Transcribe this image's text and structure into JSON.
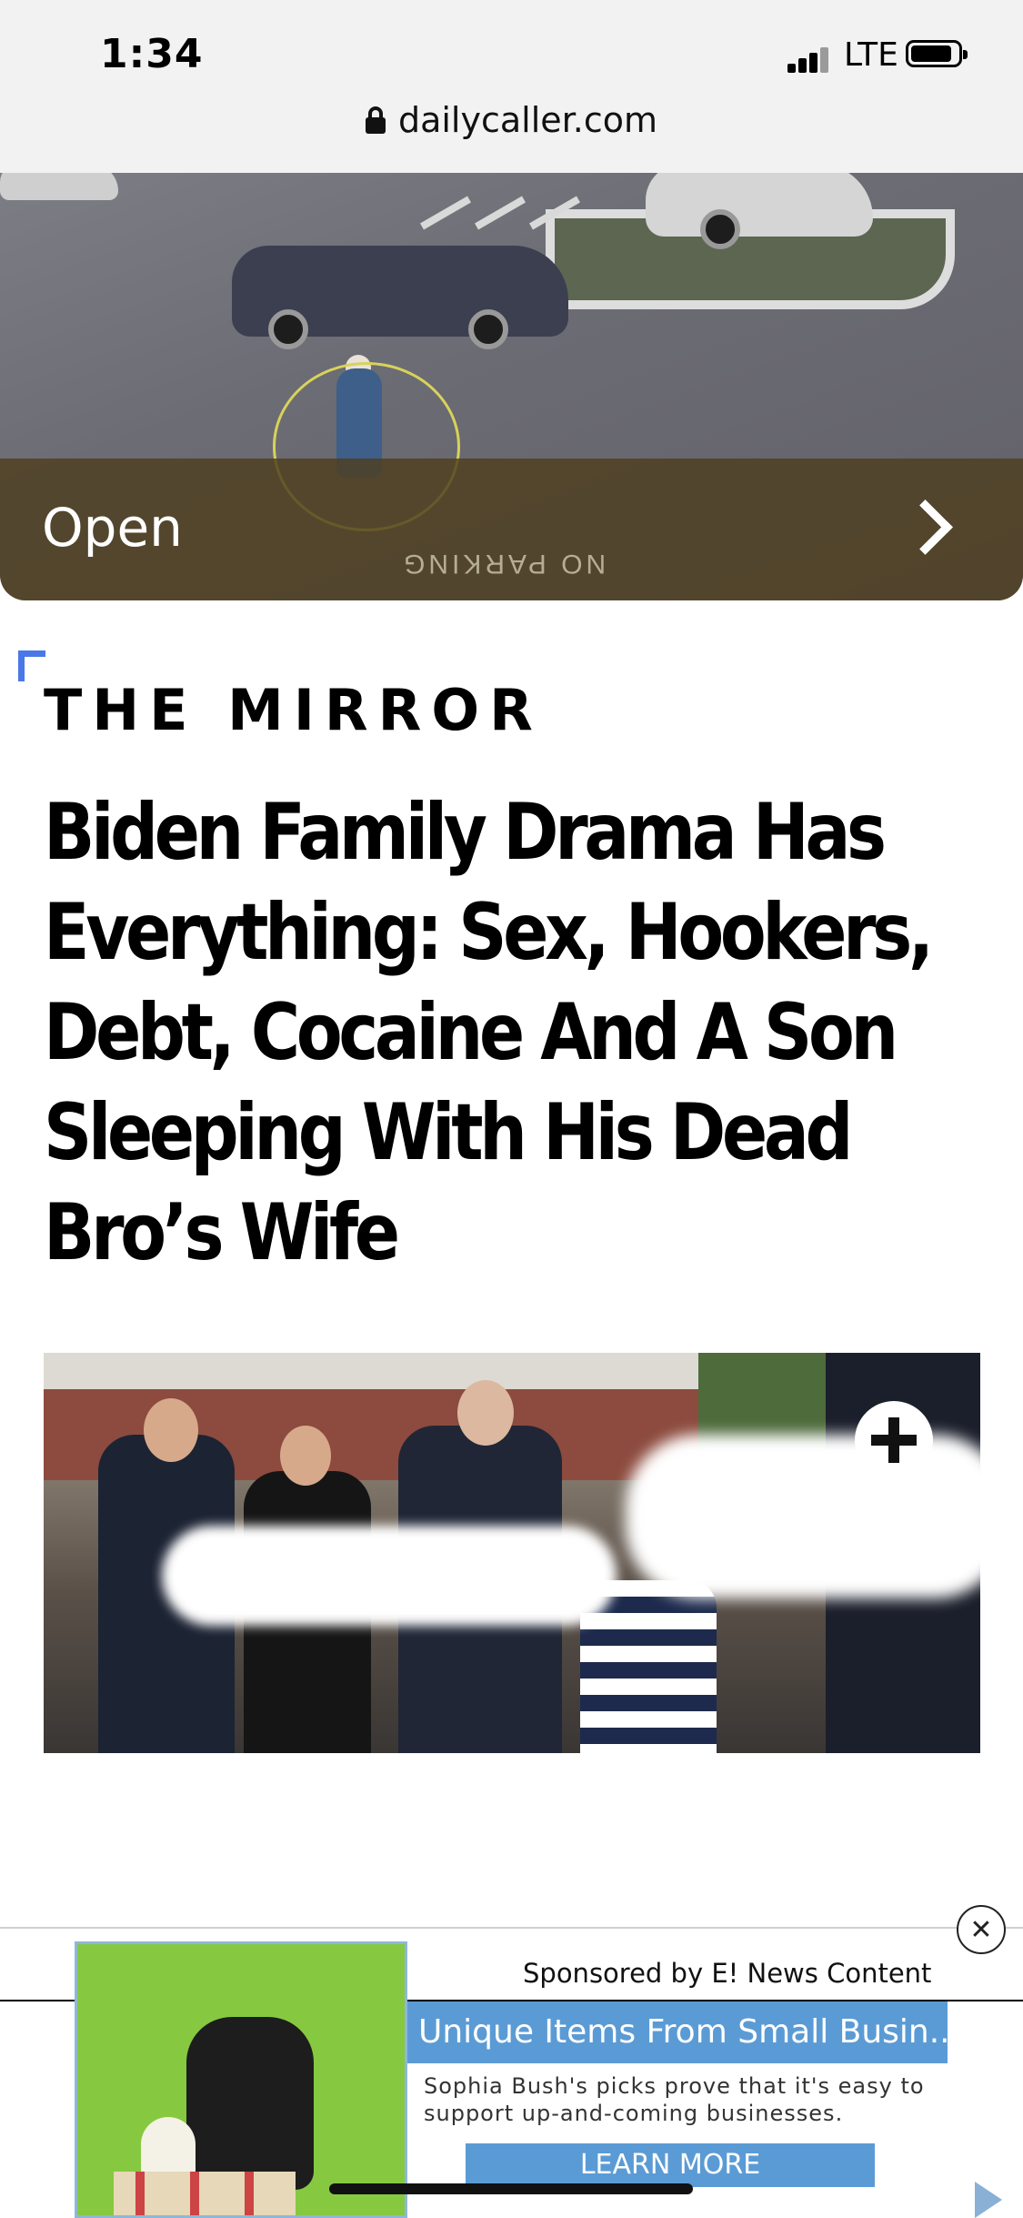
{
  "status_bar": {
    "time": "1:34",
    "network": "LTE"
  },
  "browser": {
    "url": "dailycaller.com"
  },
  "video_banner": {
    "open_label": "Open",
    "pavement_text": "NO PARKING"
  },
  "article": {
    "section": "THE MIRROR",
    "headline": "Biden Family Drama Has Everything: Sex, Hookers, Debt, Cocaine And A Son Sleeping With His Dead Bro’s Wife"
  },
  "ad": {
    "sponsor": "Sponsored by E! News Content",
    "title": "Unique Items From Small Busin...",
    "description": "Sophia Bush's picks prove that it's easy to support up-and-coming businesses.",
    "cta": "LEARN MORE"
  },
  "colors": {
    "accent_blue": "#4a78e8",
    "ad_blue": "#5b9bd5"
  },
  "icons": [
    "lock-icon",
    "signal-icon",
    "battery-icon",
    "chevron-right-icon",
    "plus-icon",
    "close-icon",
    "adchoices-icon"
  ]
}
